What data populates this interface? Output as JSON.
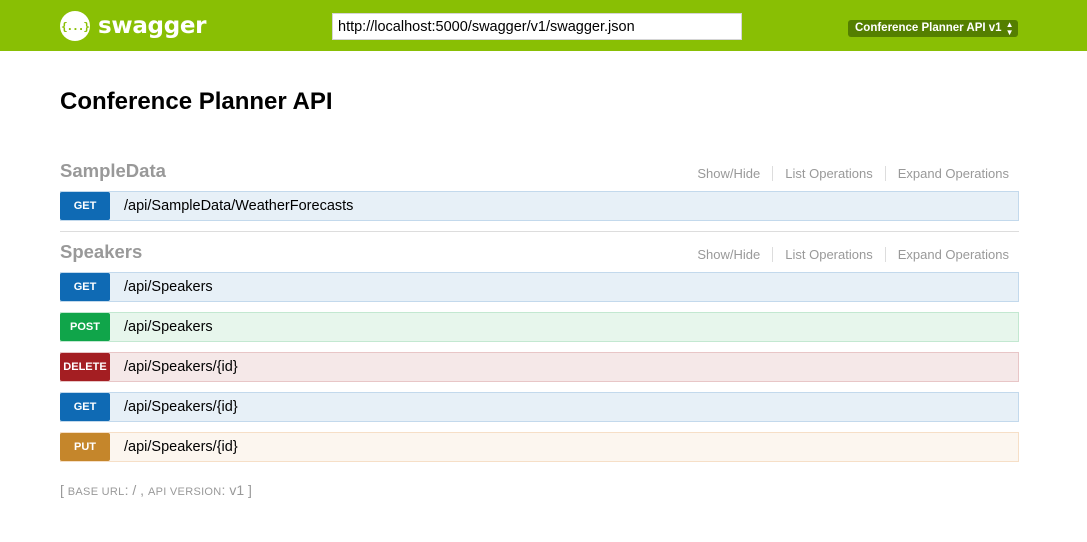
{
  "header": {
    "logo_glyph": "{...}",
    "logo_text": "swagger",
    "url_value": "http://localhost:5000/swagger/v1/swagger.json",
    "spec_selector": "Conference Planner API v1",
    "brand_color": "#89bf04"
  },
  "page": {
    "title": "Conference Planner API"
  },
  "resources": [
    {
      "name": "SampleData",
      "actions": [
        "Show/Hide",
        "List Operations",
        "Expand Operations"
      ],
      "operations": [
        {
          "method": "GET",
          "path": "/api/SampleData/WeatherForecasts"
        }
      ]
    },
    {
      "name": "Speakers",
      "actions": [
        "Show/Hide",
        "List Operations",
        "Expand Operations"
      ],
      "operations": [
        {
          "method": "GET",
          "path": "/api/Speakers"
        },
        {
          "method": "POST",
          "path": "/api/Speakers"
        },
        {
          "method": "DELETE",
          "path": "/api/Speakers/{id}"
        },
        {
          "method": "GET",
          "path": "/api/Speakers/{id}"
        },
        {
          "method": "PUT",
          "path": "/api/Speakers/{id}"
        }
      ]
    }
  ],
  "method_colors": {
    "GET": "#0f6ab4",
    "POST": "#10a54a",
    "DELETE": "#a41e22",
    "PUT": "#c5862b"
  },
  "footer": {
    "open_bracket": "[",
    "base_url_label": "base url",
    "base_url_value": "/",
    "api_version_label": "api version",
    "api_version_value": "v1",
    "close_bracket": "]"
  }
}
